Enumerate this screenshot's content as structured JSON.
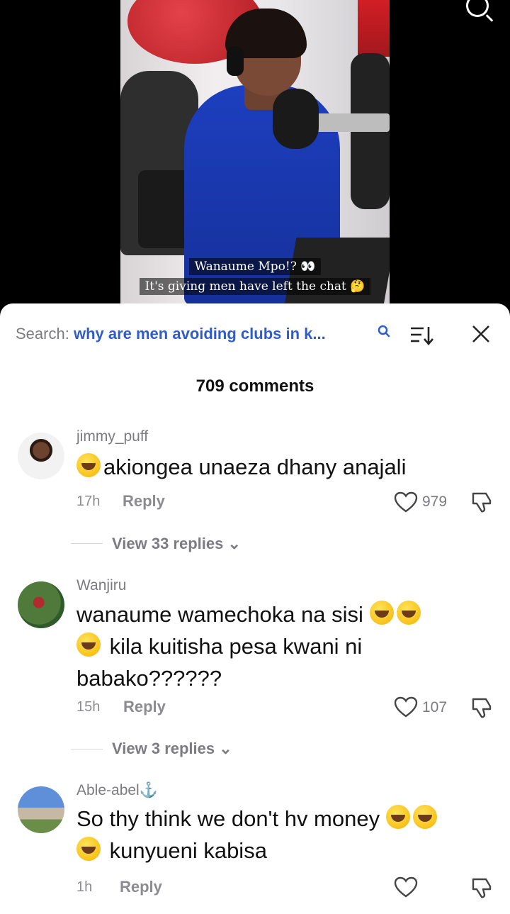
{
  "video": {
    "caption_line1": "Wanaume Mpo!? 👀",
    "caption_line2": "It's giving men have left the chat 🤔",
    "search_icon": "search-icon"
  },
  "panel": {
    "search_label": "Search:",
    "search_query": "why are men avoiding clubs in k...",
    "comment_count": "709 comments",
    "icons": [
      "search-icon",
      "sort-icon",
      "close-icon"
    ]
  },
  "comments": [
    {
      "username": "jimmy_puff",
      "text": "akiongea unaeza dhany anajali",
      "time": "17h",
      "reply_label": "Reply",
      "likes": "979",
      "view_replies": "View 33 replies ⌄"
    },
    {
      "username": "Wanjiru",
      "text_line1": "wanaume wamechoka na sisi",
      "text_line2": "kila kuitisha pesa kwani ni",
      "text_line3": "babako??????",
      "time": "15h",
      "reply_label": "Reply",
      "likes": "107",
      "view_replies": "View 3 replies ⌄"
    },
    {
      "username": "Able-abel⚓",
      "text_line1": "So thy think we don't hv money",
      "text_line2": "kunyueni kabisa",
      "time": "1h",
      "reply_label": "Reply",
      "likes": ""
    }
  ],
  "colors": {
    "accent": "#2f5cc9",
    "muted": "#7b7b80",
    "emoji": "#f5b400"
  }
}
